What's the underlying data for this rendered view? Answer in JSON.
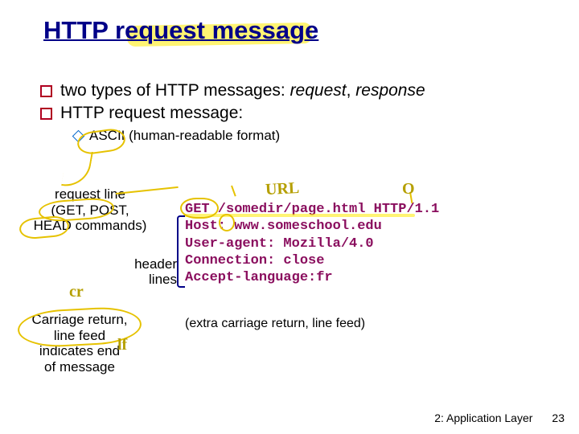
{
  "title": "HTTP request message",
  "bullet1_pre": "two types of HTTP messages: ",
  "bullet1_i1": "request",
  "bullet1_mid": ", ",
  "bullet1_i2": "response",
  "bullet2": "HTTP request message:",
  "sub1": "ASCII (human-readable format)",
  "label_request_line": "request line\n(GET, POST,\nHEAD commands)",
  "label_header_lines": "header\nlines",
  "label_carriage": "Carriage return,\nline feed\nindicates end\nof message",
  "code": "GET /somedir/page.html HTTP/1.1\nHost: www.someschool.edu \nUser-agent: Mozilla/4.0\nConnection: close\nAccept-language:fr",
  "extra": "(extra carriage return, line feed)",
  "annot_url": "URL",
  "annot_o": "O",
  "annot_cr": "cr",
  "annot_lf": "lf",
  "footer_chapter": "2: Application Layer",
  "footer_page": "23"
}
